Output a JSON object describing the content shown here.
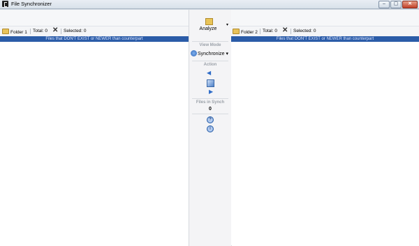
{
  "window": {
    "title": "File Synchronizer",
    "minimize": "–",
    "maximize": "▢",
    "close": "✕"
  },
  "left_pane": {
    "folder_label": "Folder 1",
    "total": "Total: 0",
    "selected": "Selected: 0",
    "banner": "Files that DON'T EXIST or NEWER than counterpart"
  },
  "right_pane": {
    "folder_label": "Folder 2",
    "total": "Total: 0",
    "selected": "Selected: 0",
    "banner": "Files that DON'T EXIST or NEWER than counterpart"
  },
  "center": {
    "analyze_label": "Analyze",
    "view_mode_title": "View Mode",
    "mode_value": "Synchronize",
    "action_title": "Action",
    "files_in_synch_title": "Files in Synch",
    "files_in_synch_value": "0",
    "help_glyph": "?",
    "info_glyph": "i"
  },
  "colors": {
    "banner": "#2b5ca8",
    "accent": "#2f6cc8"
  }
}
